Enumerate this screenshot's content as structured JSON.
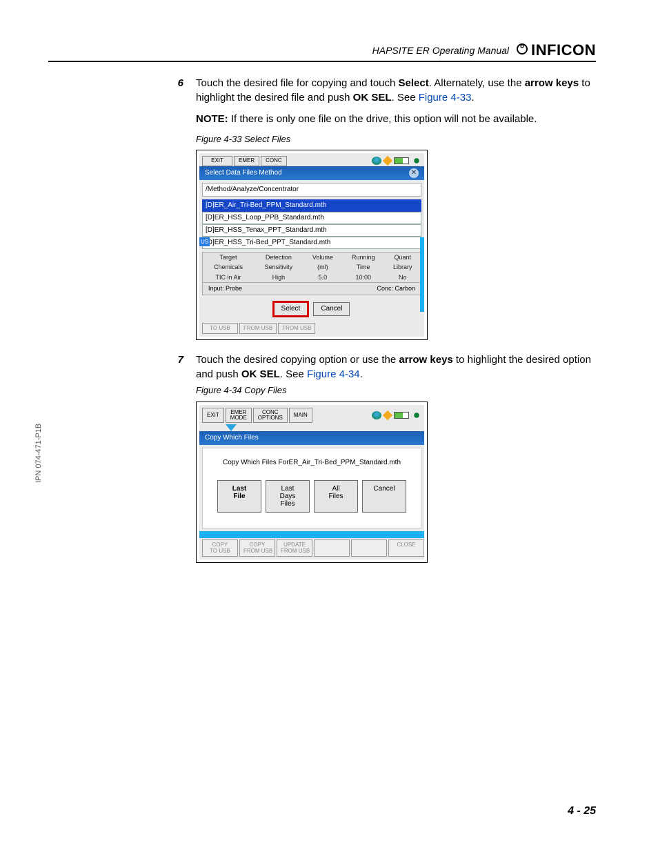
{
  "header": {
    "manual_title": "HAPSITE ER Operating Manual",
    "brand": "INFICON"
  },
  "steps": {
    "s6_num": "6",
    "s6_a": "Touch the desired file for copying and touch ",
    "s6_b": "Select",
    "s6_c": ". Alternately, use the ",
    "s6_d": "arrow keys",
    "s6_e": " to highlight the desired file and push ",
    "s6_f": "OK SEL",
    "s6_g": ". See ",
    "s6_link1": "Figure 4-33",
    "s6_note_lead": "NOTE:",
    "s6_note_body": "  If there is only one file on the drive, this option will not be available.",
    "figcap_33": "Figure 4-33  Select Files",
    "s7_num": "7",
    "s7_a": "Touch the desired copying option or use the ",
    "s7_b": "arrow keys",
    "s7_c": " to highlight the desired option and push ",
    "s7_d": "OK SEL",
    "s7_e": ". See ",
    "s7_link2": "Figure 4-34",
    "figcap_34": "Figure 4-34  Copy Files"
  },
  "fig33": {
    "tabs": {
      "exit": "EXIT",
      "emer": "EMER",
      "conc": "CONC"
    },
    "title": "Select Data Files Method",
    "path": "/Method/Analyze/Concentrator",
    "files": [
      "[D]ER_Air_Tri-Bed_PPM_Standard.mth",
      "[D]ER_HSS_Loop_PPB_Standard.mth",
      "[D]ER_HSS_Tenax_PPT_Standard.mth",
      "[D]ER_HSS_Tri-Bed_PPT_Standard.mth"
    ],
    "side_tag": "US",
    "details_h": [
      "Target",
      "Detection",
      "Volume",
      "Running",
      "Quant"
    ],
    "details_h2": [
      "Chemicals",
      "Sensitivity",
      "(ml)",
      "Time",
      "Library"
    ],
    "details_v": [
      "TIC in Air",
      "High",
      "5.0",
      "10:00",
      "No"
    ],
    "foot_l": "Input: Probe",
    "foot_r": "Conc: Carbon",
    "btn_select": "Select",
    "btn_cancel": "Cancel",
    "bot_tabs": [
      "TO USB",
      "FROM USB",
      "FROM USB"
    ]
  },
  "fig34": {
    "tabs": {
      "exit": "EXIT",
      "emer": "EMER\nMODE",
      "conc": "CONC\nOPTIONS",
      "main": "MAIN"
    },
    "title": "Copy Which Files",
    "prompt": "Copy Which Files ForER_Air_Tri-Bed_PPM_Standard.mth",
    "btns": {
      "last_file": "Last\nFile",
      "last_days": "Last\nDays\nFiles",
      "all_files": "All\nFiles",
      "cancel": "Cancel"
    },
    "bot_tabs": [
      "COPY\nTO USB",
      "COPY\nFROM USB",
      "UPDATE\nFROM USB",
      "",
      "",
      "CLOSE"
    ]
  },
  "sidecode": "IPN 074-471-P1B",
  "pagenum": "4 - 25"
}
